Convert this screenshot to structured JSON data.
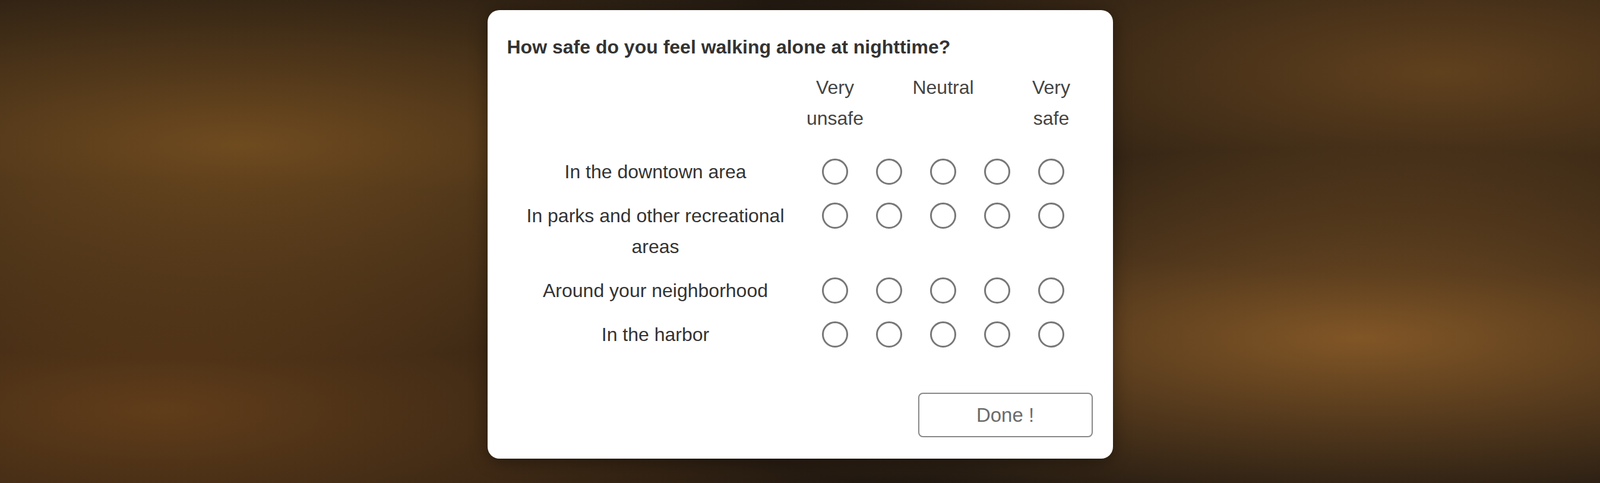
{
  "survey": {
    "question": "How safe do you feel walking alone at nighttime?",
    "scale": [
      {
        "label": "Very unsafe"
      },
      {
        "label": ""
      },
      {
        "label": "Neutral"
      },
      {
        "label": ""
      },
      {
        "label": "Very safe"
      }
    ],
    "rows": [
      {
        "label": "In the downtown area",
        "options": [
          {
            "selected": false
          },
          {
            "selected": false
          },
          {
            "selected": false
          },
          {
            "selected": false
          },
          {
            "selected": false
          }
        ]
      },
      {
        "label": "In parks and other recreational areas",
        "options": [
          {
            "selected": false
          },
          {
            "selected": false
          },
          {
            "selected": false
          },
          {
            "selected": false
          },
          {
            "selected": false
          }
        ]
      },
      {
        "label": "Around your neighborhood",
        "options": [
          {
            "selected": false
          },
          {
            "selected": false
          },
          {
            "selected": false
          },
          {
            "selected": false
          },
          {
            "selected": false
          }
        ]
      },
      {
        "label": "In the harbor",
        "options": [
          {
            "selected": false
          },
          {
            "selected": false
          },
          {
            "selected": false
          },
          {
            "selected": false
          },
          {
            "selected": false
          }
        ]
      }
    ],
    "button": {
      "label": "Done !",
      "disabled": true
    }
  }
}
